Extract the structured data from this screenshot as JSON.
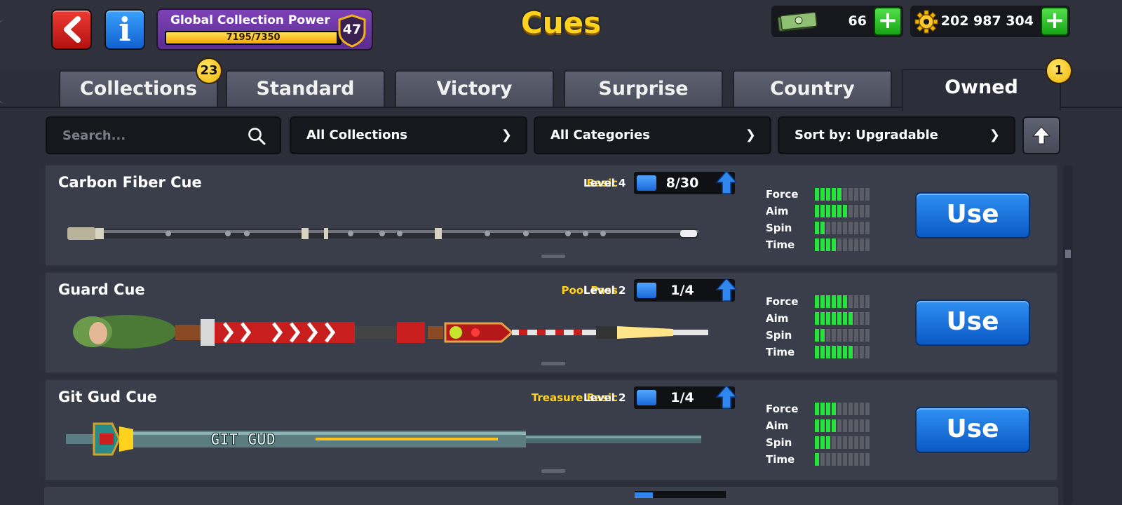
{
  "header": {
    "title": "Cues",
    "power": {
      "title": "Global Collection Power",
      "progress_text": "7195/7350",
      "current": 7195,
      "max": 7350,
      "level": "47"
    },
    "cash": {
      "value": "66"
    },
    "coins": {
      "value": "202 987 304"
    },
    "plus_label": "+"
  },
  "tabs": [
    {
      "label": "Collections",
      "badge": "23"
    },
    {
      "label": "Standard"
    },
    {
      "label": "Victory"
    },
    {
      "label": "Surprise"
    },
    {
      "label": "Country"
    },
    {
      "label": "Owned",
      "badge": "1",
      "active": true
    }
  ],
  "filters": {
    "search_placeholder": "Search...",
    "collections": "All Collections",
    "categories": "All Categories",
    "sort": "Sort by: Upgradable"
  },
  "stat_labels": {
    "force": "Force",
    "aim": "Aim",
    "spin": "Spin",
    "time": "Time"
  },
  "use_label": "Use",
  "cues": [
    {
      "name": "Carbon Fiber Cue",
      "collection": "Basic",
      "level": "Level 4",
      "progress": "8/30",
      "stats": {
        "force": 5,
        "aim": 6,
        "spin": 2,
        "time": 4
      }
    },
    {
      "name": "Guard Cue",
      "collection": "Pool Pass",
      "level": "Level 2",
      "progress": "1/4",
      "stats": {
        "force": 6,
        "aim": 7,
        "spin": 2,
        "time": 7
      }
    },
    {
      "name": "Git Gud Cue",
      "collection": "Treasure Basic",
      "level": "Level 2",
      "progress": "1/4",
      "stats": {
        "force": 4,
        "aim": 4,
        "spin": 3,
        "time": 1
      }
    }
  ],
  "git_gud_text": "GIT GUD",
  "colors": {
    "accent_yellow": "#ffd21e",
    "stat_on": "#25e33b",
    "use_blue": "#1a73dd"
  },
  "icons": {
    "back": "chevron-left-icon",
    "info": "info-icon",
    "search": "search-icon",
    "sort": "arrow-up-icon",
    "cash": "cash-icon",
    "coins": "gear-coin-icon"
  }
}
